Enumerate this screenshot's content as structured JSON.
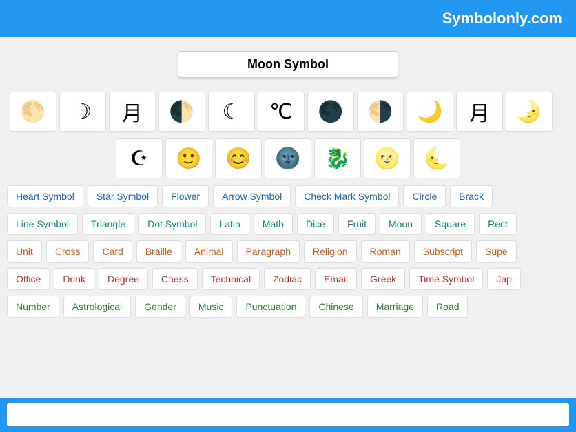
{
  "header": {
    "title": "Symbolonly.com"
  },
  "search": {
    "label": "Moon Symbol",
    "footer_placeholder": ""
  },
  "symbols_row1": [
    {
      "symbol": "🌕",
      "label": "full moon"
    },
    {
      "symbol": "☽",
      "label": "crescent moon"
    },
    {
      "symbol": "月",
      "label": "moon kanji"
    },
    {
      "symbol": "🌓",
      "label": "first quarter moon"
    },
    {
      "symbol": "☾",
      "label": "last quarter moon"
    },
    {
      "symbol": "℃",
      "label": "moon symbol"
    },
    {
      "symbol": "🌑",
      "label": "new moon"
    },
    {
      "symbol": "🌗",
      "label": "last quarter moon"
    },
    {
      "symbol": "🌙",
      "label": "crescent moon yellow"
    },
    {
      "symbol": "月",
      "label": "moon character"
    },
    {
      "symbol": "🌛",
      "label": "first quarter moon face"
    }
  ],
  "symbols_row2": [
    {
      "symbol": "☪",
      "label": "star and crescent"
    },
    {
      "symbol": "🙂",
      "label": "smiley face"
    },
    {
      "symbol": "😊",
      "label": "smiling face"
    },
    {
      "symbol": "🌚",
      "label": "new moon face"
    },
    {
      "symbol": "🐉",
      "label": "dragon"
    },
    {
      "symbol": "🌝",
      "label": "full moon face"
    },
    {
      "symbol": "🌜",
      "label": "last quarter moon face"
    }
  ],
  "categories": {
    "row1": [
      {
        "label": "Heart Symbol",
        "color": "blue"
      },
      {
        "label": "Star Symbol",
        "color": "blue"
      },
      {
        "label": "Flower",
        "color": "blue"
      },
      {
        "label": "Arrow Symbol",
        "color": "blue"
      },
      {
        "label": "Check Mark Symbol",
        "color": "blue"
      },
      {
        "label": "Circle",
        "color": "blue"
      },
      {
        "label": "Brack",
        "color": "blue"
      }
    ],
    "row2": [
      {
        "label": "Line Symbol",
        "color": "teal"
      },
      {
        "label": "Triangle",
        "color": "teal"
      },
      {
        "label": "Dot Symbol",
        "color": "teal"
      },
      {
        "label": "Latin",
        "color": "teal"
      },
      {
        "label": "Math",
        "color": "teal"
      },
      {
        "label": "Dice",
        "color": "teal"
      },
      {
        "label": "Fruit",
        "color": "teal"
      },
      {
        "label": "Moon",
        "color": "teal"
      },
      {
        "label": "Square",
        "color": "teal"
      },
      {
        "label": "Rect",
        "color": "teal"
      }
    ],
    "row3": [
      {
        "label": "Unit",
        "color": "orange"
      },
      {
        "label": "Cross",
        "color": "orange"
      },
      {
        "label": "Card",
        "color": "orange"
      },
      {
        "label": "Braille",
        "color": "orange"
      },
      {
        "label": "Animal",
        "color": "orange"
      },
      {
        "label": "Paragraph",
        "color": "orange"
      },
      {
        "label": "Religion",
        "color": "orange"
      },
      {
        "label": "Roman",
        "color": "orange"
      },
      {
        "label": "Subscript",
        "color": "orange"
      },
      {
        "label": "Supe",
        "color": "orange"
      }
    ],
    "row4": [
      {
        "label": "Office",
        "color": "red"
      },
      {
        "label": "Drink",
        "color": "red"
      },
      {
        "label": "Degree",
        "color": "red"
      },
      {
        "label": "Chess",
        "color": "red"
      },
      {
        "label": "Technical",
        "color": "red"
      },
      {
        "label": "Zodiac",
        "color": "red"
      },
      {
        "label": "Email",
        "color": "red"
      },
      {
        "label": "Greek",
        "color": "red"
      },
      {
        "label": "Time Symbol",
        "color": "red"
      },
      {
        "label": "Jap",
        "color": "red"
      }
    ],
    "row5": [
      {
        "label": "Number",
        "color": "green"
      },
      {
        "label": "Astrological",
        "color": "green"
      },
      {
        "label": "Gender",
        "color": "green"
      },
      {
        "label": "Music",
        "color": "green"
      },
      {
        "label": "Punctuation",
        "color": "green"
      },
      {
        "label": "Chinese",
        "color": "green"
      },
      {
        "label": "Marriage",
        "color": "green"
      },
      {
        "label": "Road",
        "color": "green"
      }
    ]
  }
}
